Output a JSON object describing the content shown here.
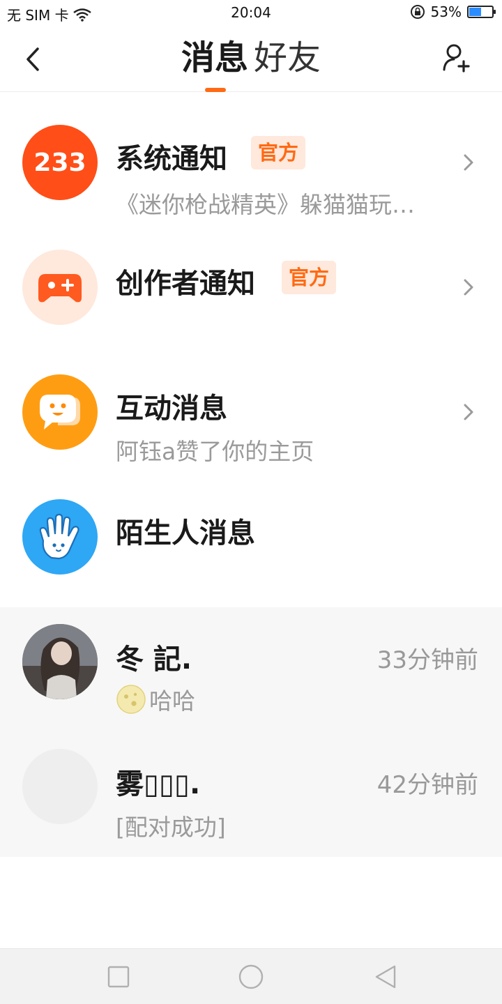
{
  "status_bar": {
    "carrier": "无 SIM 卡",
    "time": "20:04",
    "battery_percent_text": "53%",
    "battery_level": 0.53
  },
  "header": {
    "tabs": [
      "消息",
      "好友"
    ],
    "active_tab": "消息"
  },
  "system_rows": [
    {
      "title": "系统通知",
      "badge": "官方",
      "subtitle": "《迷你枪战精英》躲猫猫玩…",
      "icon": "233-logo-icon"
    },
    {
      "title": "创作者通知",
      "badge": "官方",
      "subtitle": "",
      "icon": "gamepad-icon"
    },
    {
      "title": "互动消息",
      "badge": "",
      "subtitle": "阿钰a赞了你的主页",
      "icon": "smile-chat-icon"
    },
    {
      "title": "陌生人消息",
      "badge": "",
      "subtitle": "",
      "icon": "waving-hand-icon"
    }
  ],
  "chats": [
    {
      "name": "冬 記.",
      "time": "33分钟前",
      "message": "哈哈",
      "emoji": "moon-face-icon"
    },
    {
      "name": "雾▯▯▯.",
      "time": "42分钟前",
      "message": "[配对成功]"
    }
  ],
  "colors": {
    "accent": "#ff6a13",
    "badge_bg": "#ffe8dc",
    "system_icon_1": "#ff4e17",
    "system_icon_2_bg": "#ffe8dc",
    "system_icon_3": "#ff9d12",
    "system_icon_4": "#2ea7f5"
  }
}
